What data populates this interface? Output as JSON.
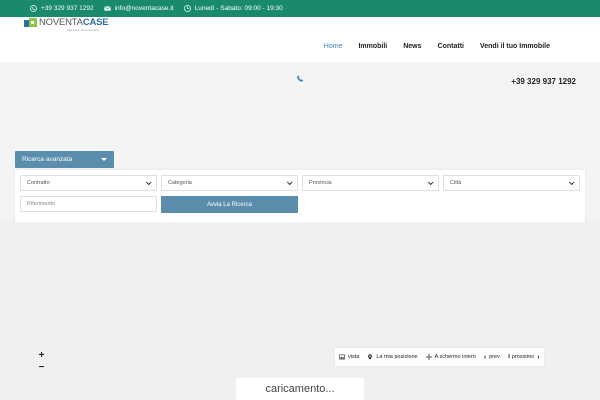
{
  "topbar": {
    "phone": "+39 329 937 1292",
    "email": "info@noventacase.it",
    "hours": "Lunedì - Sabato: 09:00 - 19:30"
  },
  "logo": {
    "text_novanta": "NOVENTA",
    "text_case": "CASE",
    "subtitle": "agenzia immobiliare"
  },
  "nav": {
    "items": [
      "Home",
      "Immobili",
      "News",
      "Contatti",
      "Vendi il tuo Immobile"
    ]
  },
  "hero": {
    "phone": "+39 329 937 1292"
  },
  "search": {
    "toggle_label": "Ricerca avanzata",
    "contratto": "Contratto",
    "categoria": "Categoria",
    "provincia": "Provincia",
    "citta": "Città",
    "riferimento_placeholder": "Riferimento",
    "button_label": "Avvia La Ricerca"
  },
  "map": {
    "zoom_in": "+",
    "zoom_out": "−",
    "controls": {
      "view": "vista",
      "my_position": "La mia posizione",
      "fullscreen": "A schermo intero",
      "prev": "prev",
      "next": "il prossimo"
    },
    "loading": "caricamento..."
  },
  "colors": {
    "topbar": "#1a8a6e",
    "accent": "#5b8eac",
    "nav_active": "#3d84b8"
  }
}
